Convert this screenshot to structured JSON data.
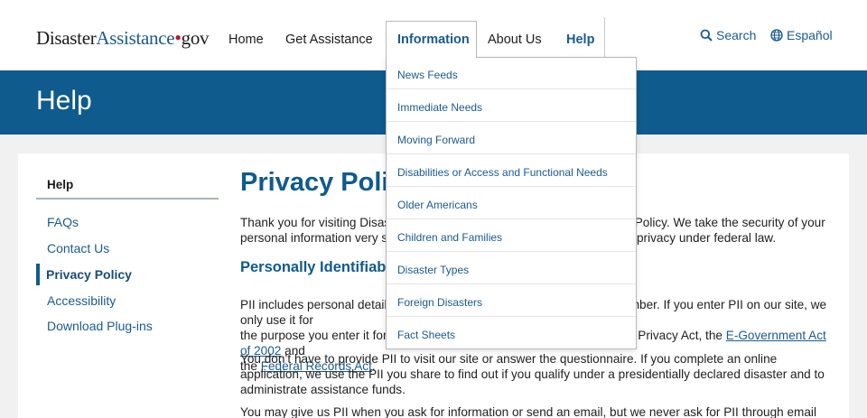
{
  "header": {
    "logo": {
      "part1": "Disaster",
      "part2": "Assistance",
      "dot": "•",
      "part3": "gov"
    },
    "nav": [
      "Home",
      "Get Assistance",
      "Information",
      "About Us",
      "Help"
    ],
    "search_label": "Search",
    "language_label": "Español"
  },
  "banner": {
    "title": "Help"
  },
  "dropdown": {
    "items": [
      "News Feeds",
      "Immediate Needs",
      "Moving Forward",
      "Disabilities or Access and Functional Needs",
      "Older Americans",
      "Children and Families",
      "Disaster Types",
      "Foreign Disasters",
      "Fact Sheets"
    ]
  },
  "sidebar": {
    "title": "Help",
    "items": [
      "FAQs",
      "Contact Us",
      "Privacy Policy",
      "Accessibility",
      "Download Plug-ins"
    ],
    "active_index": 2
  },
  "main": {
    "title": "Privacy Policy",
    "intro_1": "Thank you for visiting DisasterAssistance.gov and reviewing our Privacy Policy. We take the security of your",
    "intro_2": "personal information very seriously and are committed to protecting your privacy under federal law.",
    "pii_heading": "Personally Identifiable Information (PII)",
    "pii_1": "PII includes personal details such as your name, address and phone number. If you enter PII on our site, we only use it for",
    "pii_2": "the purpose you enter it for. We protect your information according to the Privacy Act, the",
    "link_egov": "E-Government Act of 2002",
    "pii_2_end": " and",
    "pii_3_pre": "the ",
    "link_records": "Federal Records Act",
    "pii_3_end": ".",
    "para3_1": "You don’t have to provide PII to visit our site or answer the questionnaire. If you complete an online",
    "para3_2": "application, we use the PII you share to find out if you qualify under a presidentially declared disaster and to",
    "para3_3": "administrate assistance funds.",
    "para4_1": "You may give us PII when you ask for information or send an email, but we never ask for PII through email"
  },
  "colors": {
    "brand_blue": "#0f5b8d",
    "link_blue": "#1a5a8f",
    "gov_red": "#c4122f"
  }
}
